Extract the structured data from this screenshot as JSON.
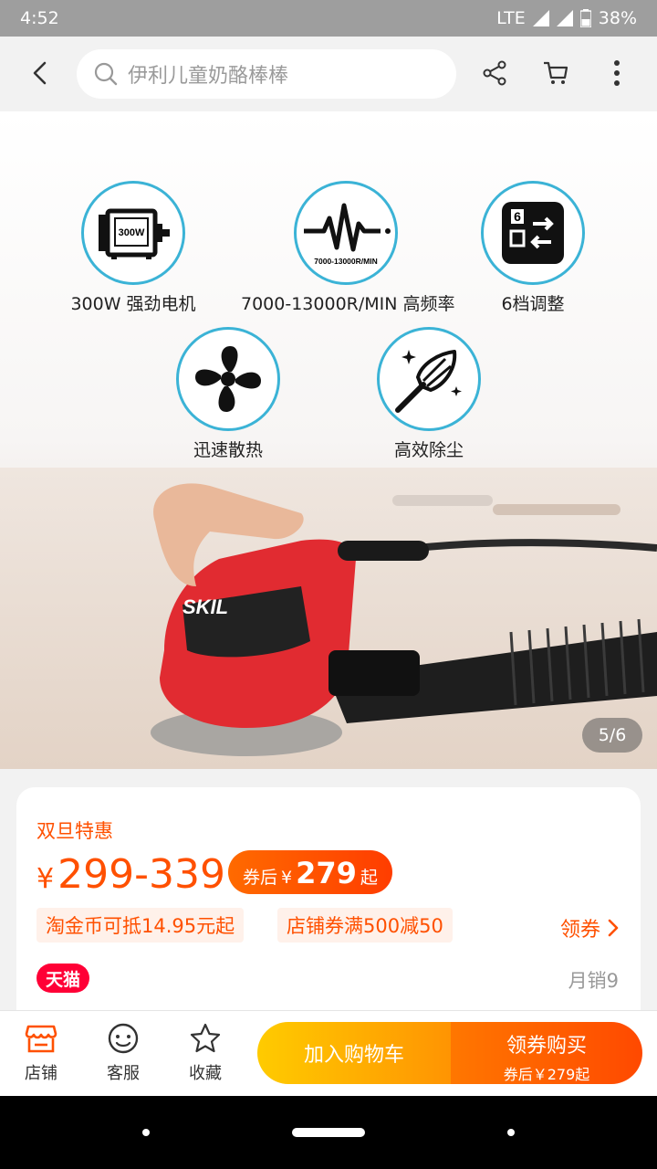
{
  "status_bar": {
    "time": "4:52",
    "network": "LTE",
    "battery": "38%"
  },
  "search": {
    "placeholder": "伊利儿童奶酪棒棒"
  },
  "icons": {
    "back": "back-arrow-icon",
    "search": "search-icon",
    "share": "share-icon",
    "cart": "cart-icon",
    "more": "more-vertical-icon"
  },
  "hero": {
    "features": [
      {
        "label": "300W 强劲电机",
        "badge": "300W"
      },
      {
        "label": "7000-13000R/MIN  高频率",
        "badge": "7000-13000R/MIN"
      },
      {
        "label": "6档调整",
        "badge": "6"
      },
      {
        "label": "迅速散热"
      },
      {
        "label": "高效除尘"
      }
    ],
    "product_brand": "SKIL",
    "counter": "5/6"
  },
  "product": {
    "promo_tag": "双旦特惠",
    "currency": "¥",
    "price_range": "299-339",
    "coupon_price": {
      "prefix": "券后",
      "currency": "¥",
      "amount": "279",
      "suffix": "起"
    },
    "chips": [
      "淘金币可抵14.95元起",
      "店铺券满500减50"
    ],
    "get_coupon": "领券",
    "platform_badge": "天猫",
    "monthly_sales": "月销9"
  },
  "bottom_bar": {
    "tabs": [
      {
        "label": "店铺",
        "icon": "store-icon"
      },
      {
        "label": "客服",
        "icon": "customer-service-icon"
      },
      {
        "label": "收藏",
        "icon": "star-icon"
      }
    ],
    "add_to_cart": "加入购物车",
    "buy": {
      "title": "领券购买",
      "subtitle": "券后￥279起"
    }
  },
  "colors": {
    "accent": "#ff5000",
    "cart_yellow": "#ffcb00",
    "buy_orange": "#ff4900",
    "tmall_red": "#ff0036",
    "feature_ring": "#3bb3d6"
  }
}
